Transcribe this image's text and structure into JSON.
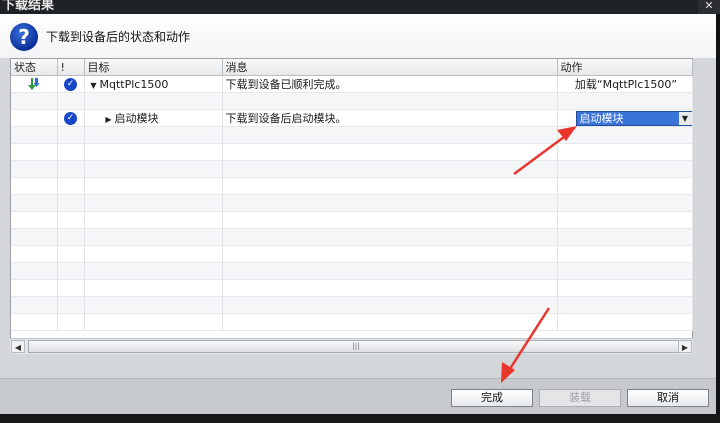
{
  "window": {
    "title": "下载结果",
    "close_glyph": "✕"
  },
  "header": {
    "icon": "question-icon",
    "icon_glyph": "?",
    "text": "下载到设备后的状态和动作"
  },
  "columns": {
    "status": "状态",
    "flag": "!",
    "target": "目标",
    "message": "消息",
    "action": "动作"
  },
  "rows": [
    {
      "target": "MqttPlc1500",
      "message": "下载到设备已顺利完成。",
      "action": "加载“MqttPlc1500”"
    },
    {
      "target": "启动模块",
      "message": "下载到设备后启动模块。",
      "action": "启动模块"
    }
  ],
  "scrollbar": {
    "grip": "|||"
  },
  "buttons": {
    "finish": "完成",
    "load": "装载",
    "cancel": "取消"
  },
  "colors": {
    "accent": "#3a74d8",
    "check": "#1747c8",
    "annotation": "#e8362c"
  }
}
